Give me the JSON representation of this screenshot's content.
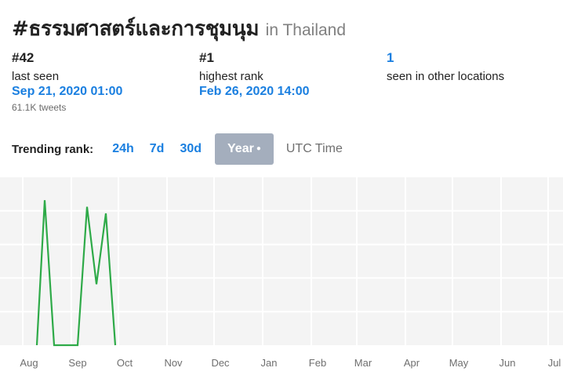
{
  "header": {
    "hashtag": "#ธรรมศาสตร์และการชุมนุม",
    "location": "in Thailand"
  },
  "stats": {
    "last_seen": {
      "rank": "#42",
      "label": "last seen",
      "date": "Sep 21, 2020 01:00",
      "tweets": "61.1K tweets"
    },
    "highest_rank": {
      "rank": "#1",
      "label": "highest rank",
      "date": "Feb 26, 2020 14:00"
    },
    "other_locations": {
      "count": "1",
      "label": "seen in other locations"
    }
  },
  "rank_controls": {
    "label": "Trending rank:",
    "options": [
      "24h",
      "7d",
      "30d",
      "Year"
    ],
    "selected": "Year",
    "timezone": "UTC Time"
  },
  "colors": {
    "accent": "#1a7fe0",
    "line": "#2eaa48",
    "active_button": "#a4aebd"
  },
  "chart_data": {
    "type": "line",
    "title": "",
    "xlabel": "",
    "ylabel": "",
    "x_ticks": [
      "Aug",
      "Sep",
      "Oct",
      "Nov",
      "Dec",
      "Jan",
      "Feb",
      "Mar",
      "Apr",
      "May",
      "Jun",
      "Jul"
    ],
    "series": [
      {
        "values": [
          {
            "x": "2019-08-10",
            "y": 0
          },
          {
            "x": "2019-08-15",
            "y": 0.88
          },
          {
            "x": "2019-08-21",
            "y": 0
          },
          {
            "x": "2019-09-05",
            "y": 0
          },
          {
            "x": "2019-09-11",
            "y": 0.84
          },
          {
            "x": "2019-09-17",
            "y": 0.37
          },
          {
            "x": "2019-09-23",
            "y": 0.8
          },
          {
            "x": "2019-09-29",
            "y": 0
          }
        ]
      }
    ],
    "ylim": [
      0,
      1
    ],
    "grid": true
  }
}
